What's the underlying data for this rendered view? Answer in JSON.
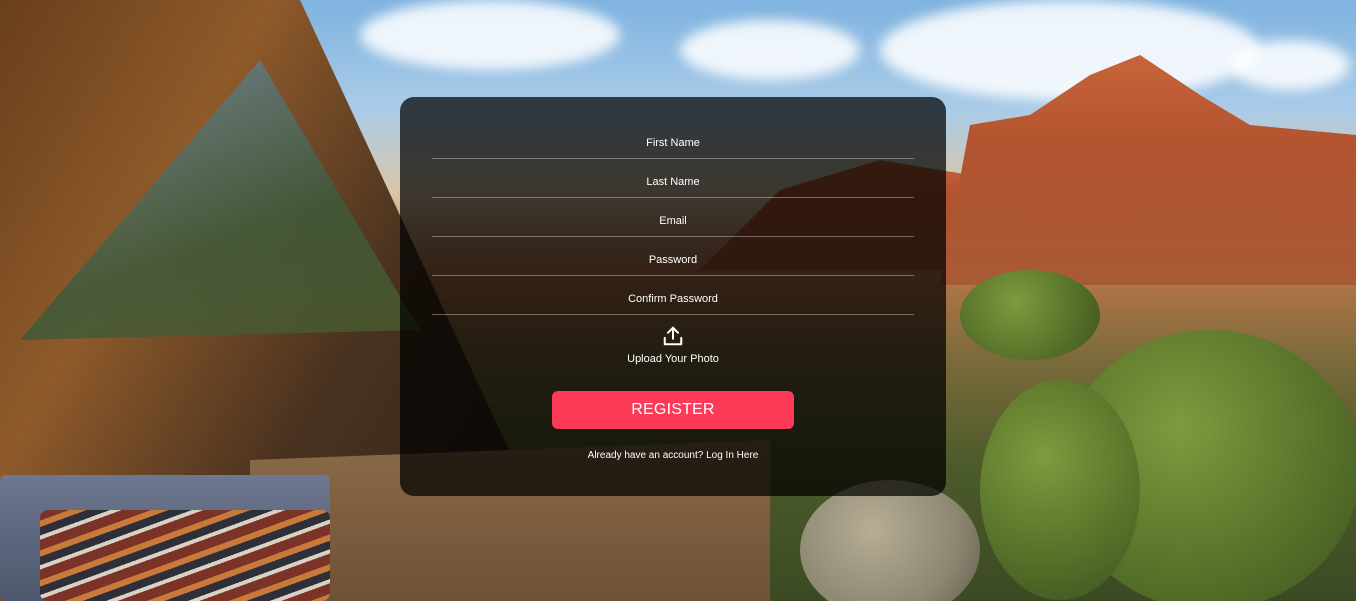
{
  "form": {
    "fields": [
      {
        "placeholder": "First Name",
        "value": ""
      },
      {
        "placeholder": "Last Name",
        "value": ""
      },
      {
        "placeholder": "Email",
        "value": ""
      },
      {
        "placeholder": "Password",
        "value": ""
      },
      {
        "placeholder": "Confirm Password",
        "value": ""
      }
    ],
    "upload": {
      "icon": "upload-icon",
      "label": "Upload Your Photo"
    },
    "register_label": "REGISTER",
    "login_prompt": "Already have an account?",
    "login_link": "Log In Here"
  },
  "colors": {
    "card_background": "#000000",
    "accent": "#fd3a57",
    "text": "#ffffff"
  }
}
